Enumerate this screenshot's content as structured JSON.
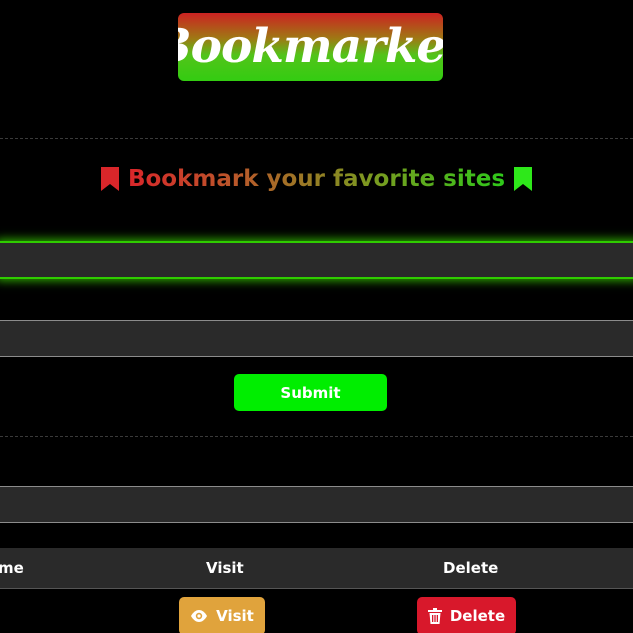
{
  "app": {
    "logo_text": "Bookmarker"
  },
  "header": {
    "tagline": "Bookmark your favorite sites",
    "tagline_icon_left": "bookmark-icon",
    "tagline_icon_right": "bookmark-icon"
  },
  "form": {
    "site_name_value": "",
    "site_url_value": "",
    "submit_label": "Submit"
  },
  "search": {
    "value": ""
  },
  "table": {
    "columns": [
      "me",
      "Visit",
      "Delete"
    ],
    "rows": [
      {
        "visit_label": "Visit",
        "visit_icon": "eye-icon",
        "delete_label": "Delete",
        "delete_icon": "trash-icon"
      }
    ]
  },
  "colors": {
    "background": "#000000",
    "input_background": "#2a2a2a",
    "focus_glow": "#2fcc00",
    "submit": "#00ee00",
    "visit": "#e0a33c",
    "delete": "#d8182b",
    "gradient_start": "#d9262a",
    "gradient_end": "#2ec81a"
  }
}
